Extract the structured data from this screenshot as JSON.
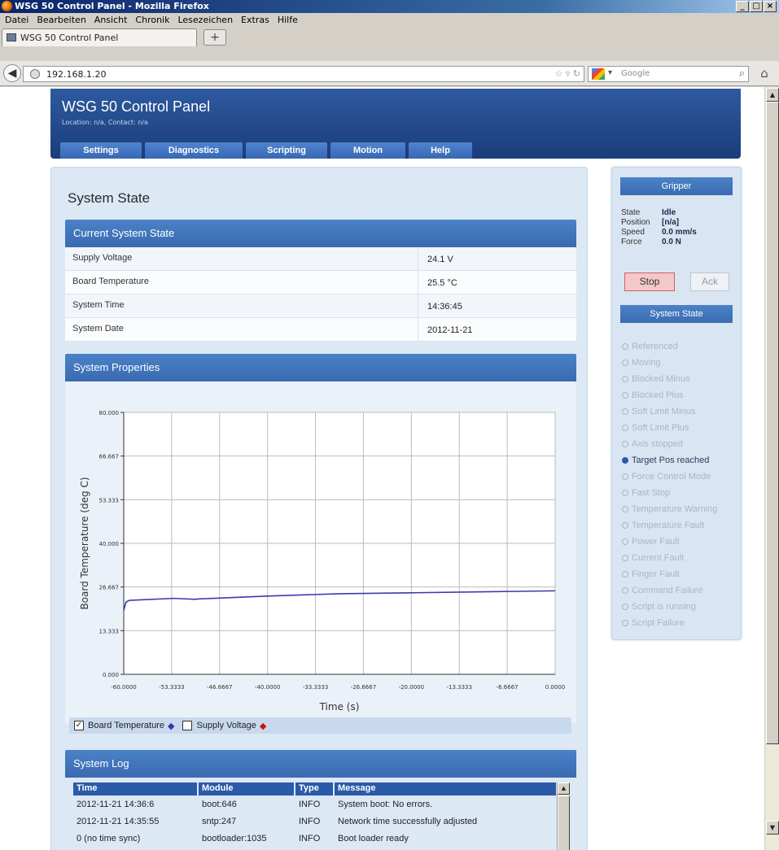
{
  "window": {
    "title": "WSG 50 Control Panel - Mozilla Firefox"
  },
  "menu": [
    "Datei",
    "Bearbeiten",
    "Ansicht",
    "Chronik",
    "Lesezeichen",
    "Extras",
    "Hilfe"
  ],
  "browser": {
    "tab_title": "WSG 50 Control Panel",
    "new_tab": "+",
    "url": "192.168.1.20",
    "search_placeholder": "Google"
  },
  "site": {
    "title": "WSG 50 Control Panel",
    "subtitle": "Location: n/a, Contact: n/a",
    "nav": [
      "Settings",
      "Diagnostics",
      "Scripting",
      "Motion",
      "Help"
    ]
  },
  "main": {
    "heading": "System State",
    "current_state": {
      "title": "Current System State",
      "rows": [
        {
          "label": "Supply Voltage",
          "value": "24.1 V"
        },
        {
          "label": "Board Temperature",
          "value": "25.5 °C"
        },
        {
          "label": "System Time",
          "value": "14:36:45"
        },
        {
          "label": "System Date",
          "value": "2012-11-21"
        }
      ]
    },
    "properties_title": "System Properties",
    "legend": {
      "board_temperature": {
        "label": "Board Temperature",
        "checked": true,
        "color": "#2a3aa8"
      },
      "supply_voltage": {
        "label": "Supply Voltage",
        "checked": false,
        "color": "#cc1111"
      }
    },
    "log": {
      "title": "System Log",
      "columns": [
        "Time",
        "Module",
        "Type",
        "Message"
      ],
      "rows": [
        [
          "2012-11-21 14:36:6",
          "boot:646",
          "INFO",
          "System boot: No errors."
        ],
        [
          "2012-11-21 14:35:55",
          "sntp:247",
          "INFO",
          "Network time successfully adjusted"
        ],
        [
          "0 (no time sync)",
          "bootloader:1035",
          "INFO",
          "Boot loader ready"
        ]
      ]
    }
  },
  "chart_data": {
    "type": "line",
    "xlabel": "Time  (s)",
    "ylabel": "Board Temperature  (deg C)",
    "xlim": [
      -60,
      0
    ],
    "ylim": [
      0,
      80
    ],
    "x_ticks": [
      "-60.0000",
      "-53.3333",
      "-46.6667",
      "-40.0000",
      "-33.3333",
      "-26.6667",
      "-20.0000",
      "-13.3333",
      "-6.6667",
      "0.0000"
    ],
    "y_ticks": [
      "80.000",
      "66.667",
      "53.333",
      "40.000",
      "26.667",
      "13.333",
      "0.000"
    ],
    "grid": true,
    "series": [
      {
        "name": "Board Temperature",
        "color": "#3a3ab0",
        "x": [
          -60,
          -59.7,
          -59.4,
          -59.2,
          -53,
          -50,
          -49.8,
          -40,
          -30,
          -20,
          -10,
          0
        ],
        "y": [
          19.5,
          22.0,
          22.4,
          22.6,
          23.2,
          22.9,
          23.0,
          23.9,
          24.6,
          24.9,
          25.2,
          25.5
        ]
      }
    ]
  },
  "side": {
    "gripper_title": "Gripper",
    "status": [
      {
        "label": "State",
        "value": "Idle"
      },
      {
        "label": "Position",
        "value": "[n/a]"
      },
      {
        "label": "Speed",
        "value": "0.0 mm/s"
      },
      {
        "label": "Force",
        "value": "0.0 N"
      }
    ],
    "stop_label": "Stop",
    "ack_label": "Ack",
    "system_state_title": "System State",
    "flags": [
      {
        "label": "Referenced",
        "active": false
      },
      {
        "label": "Moving",
        "active": false
      },
      {
        "label": "Blocked Minus",
        "active": false
      },
      {
        "label": "Blocked Plus",
        "active": false
      },
      {
        "label": "Soft Limit Minus",
        "active": false
      },
      {
        "label": "Soft Limit Plus",
        "active": false
      },
      {
        "label": "Axis stopped",
        "active": false
      },
      {
        "label": "Target Pos reached",
        "active": true
      },
      {
        "label": "Force Control Mode",
        "active": false
      },
      {
        "label": "Fast Stop",
        "active": false
      },
      {
        "label": "Temperature Warning",
        "active": false
      },
      {
        "label": "Temperature Fault",
        "active": false
      },
      {
        "label": "Power Fault",
        "active": false
      },
      {
        "label": "Current Fault",
        "active": false
      },
      {
        "label": "Finger Fault",
        "active": false
      },
      {
        "label": "Command Failure",
        "active": false
      },
      {
        "label": "Script is running",
        "active": false
      },
      {
        "label": "Script Failure",
        "active": false
      }
    ]
  }
}
